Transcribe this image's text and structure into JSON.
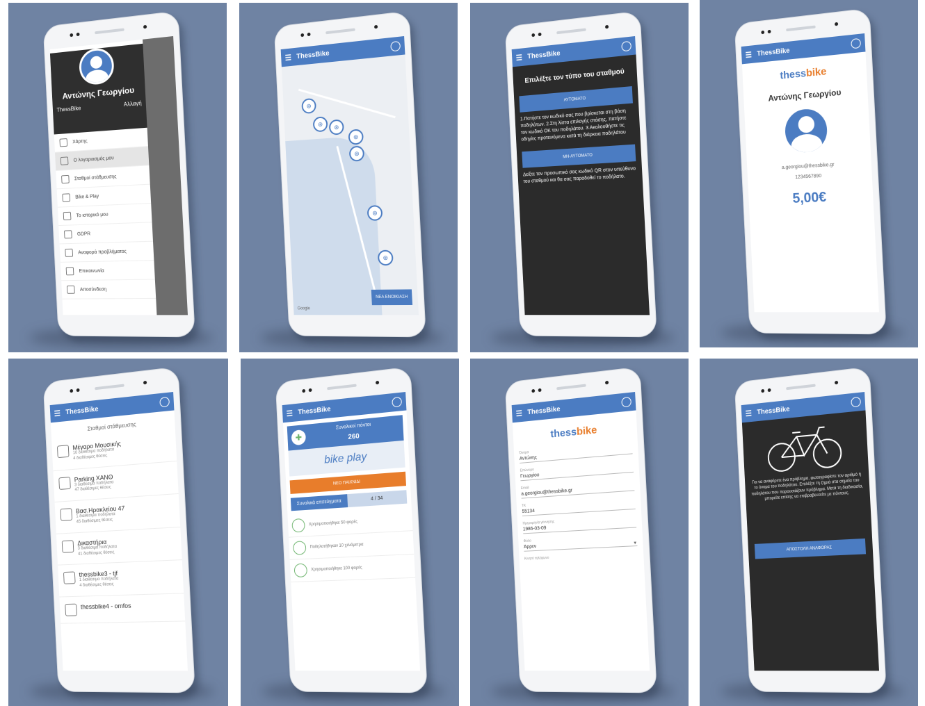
{
  "app": {
    "title": "ThessBike"
  },
  "drawer": {
    "user_name": "Αντώνης Γεωργίου",
    "brand": "ThessBike",
    "link": "Αλλαγή",
    "items": [
      {
        "label": "Χάρτης",
        "icon": "map-icon"
      },
      {
        "label": "Ο λογαριασμός μου",
        "icon": "account-icon"
      },
      {
        "label": "Σταθμοί στάθμευσης",
        "icon": "station-icon"
      },
      {
        "label": "Bike & Play",
        "icon": "play-icon"
      },
      {
        "label": "Το ιστορικό μου",
        "icon": "history-icon"
      },
      {
        "label": "GDPR",
        "icon": "gdpr-icon"
      },
      {
        "label": "Αναφορά προβλήματος",
        "icon": "report-icon"
      },
      {
        "label": "Επικοινωνία",
        "icon": "contact-icon"
      },
      {
        "label": "Αποσύνδεση",
        "icon": "logout-icon"
      }
    ]
  },
  "map_screen": {
    "new_rental": "ΝΕΑ ΕΝΟΙΚΙΑΣΗ",
    "map_credit": "Google",
    "pin_icon": "bike-pin-icon"
  },
  "station_type": {
    "title": "Επιλέξτε τον τύπο του σταθμού",
    "auto_button": "ΑΥΤΟΜΑΤΟ",
    "instructions": "1.Πατήστε τον κωδικό σας που βρίσκεται στη βάση ποδηλάτων. 2.Στη λίστα επιλογής στάσης, πατήστε τον κωδικό ΟΚ του ποδηλάτου. 3.Ακολουθήστε τις οδηγίες προτεινόμενα κατά τη διάρκεια ποδηλάτου",
    "manual_button": "ΜΗ-ΑΥΤΟΜΑΤΟ",
    "manual_text": "Δείξτε τον προσωπικό σας κωδικό QR στον υπεύθυνο του σταθμού και θα σας παραδοθεί το ποδήλατο."
  },
  "account": {
    "logo_main": "thess",
    "logo_accent": "bike",
    "name": "Αντώνης Γεωργίου",
    "email": "a.georgiou@thessbike.gr",
    "phone": "1234567890",
    "balance": "5,00€"
  },
  "stations": {
    "title": "Σταθμοί στάθμευσης",
    "items": [
      {
        "name": "Μέγαρο Μουσικής",
        "line1": "10 διαθέσιμα ποδήλατα",
        "line2": "4 διαθέσιμες θέσεις"
      },
      {
        "name": "Parking ΧΑΝΘ",
        "line1": "3 διαθέσιμα ποδήλατα",
        "line2": "47 διαθέσιμες θέσεις"
      },
      {
        "name": "Βασ.Ηρακλείου 47",
        "line1": "1 διαθέσιμα ποδήλατα",
        "line2": "45 διαθέσιμες θέσεις"
      },
      {
        "name": "Δικαστήρια",
        "line1": "3 διαθέσιμα ποδήλατα",
        "line2": "41 διαθέσιμες θέσεις"
      },
      {
        "name": "thessbike3 - tjf",
        "line1": "1 διαθέσιμα ποδήλατα",
        "line2": "4 διαθέσιμες θέσεις"
      },
      {
        "name": "thessbike4 - omfos",
        "line1": "",
        "line2": ""
      }
    ]
  },
  "play": {
    "points_label": "Συνολικοί πόντοι",
    "points": "260",
    "logo_text": "bike play",
    "new_game": "ΝΕΟ ΠΑΙΧΝΙΔΙ",
    "achievements_label": "Συνολικά επιτεύγματα",
    "achievements_count": "4 / 34",
    "achievements": [
      "Χρησιμοποιήθηκε 50 φορές",
      "Ποδηλατήθηκαν 10 χιλιόμετρα",
      "Χρησιμοποιήθηκε 100 φορές"
    ]
  },
  "profile_form": {
    "fields": [
      {
        "label": "Όνομα",
        "value": "Αντώνης"
      },
      {
        "label": "Επώνυμο",
        "value": "Γεωργίου"
      },
      {
        "label": "Email",
        "value": "a.georgiou@thessbike.gr"
      },
      {
        "label": "ΤΚ",
        "value": "55134"
      },
      {
        "label": "Ημερομηνία γέννησης",
        "value": "1986-03-09"
      },
      {
        "label": "Φύλο",
        "value": "Άρρεν"
      }
    ],
    "footer_label": "Κινητό τηλέφωνο"
  },
  "report": {
    "text": "Για να αναφέρετε ένα πρόβλημα, φωτογραφίστε τον αριθμό ή το όνομα του ποδηλάτου. Επιλέξτε τη ζημιά στα σημεία του ποδηλάτου που παρουσιάζουν πρόβλημα. Μετά τη διαδικασία, μπορείτε επίσης να επιβραβευτείτε με πόντους.",
    "send_button": "ΑΠΟΣΤΟΛΗ ΑΝΑΦΟΡΑΣ"
  },
  "colors": {
    "primary": "#4b7cc2",
    "accent": "#e87d2b",
    "background": "#6f83a3",
    "dark": "#2b2b2b"
  }
}
